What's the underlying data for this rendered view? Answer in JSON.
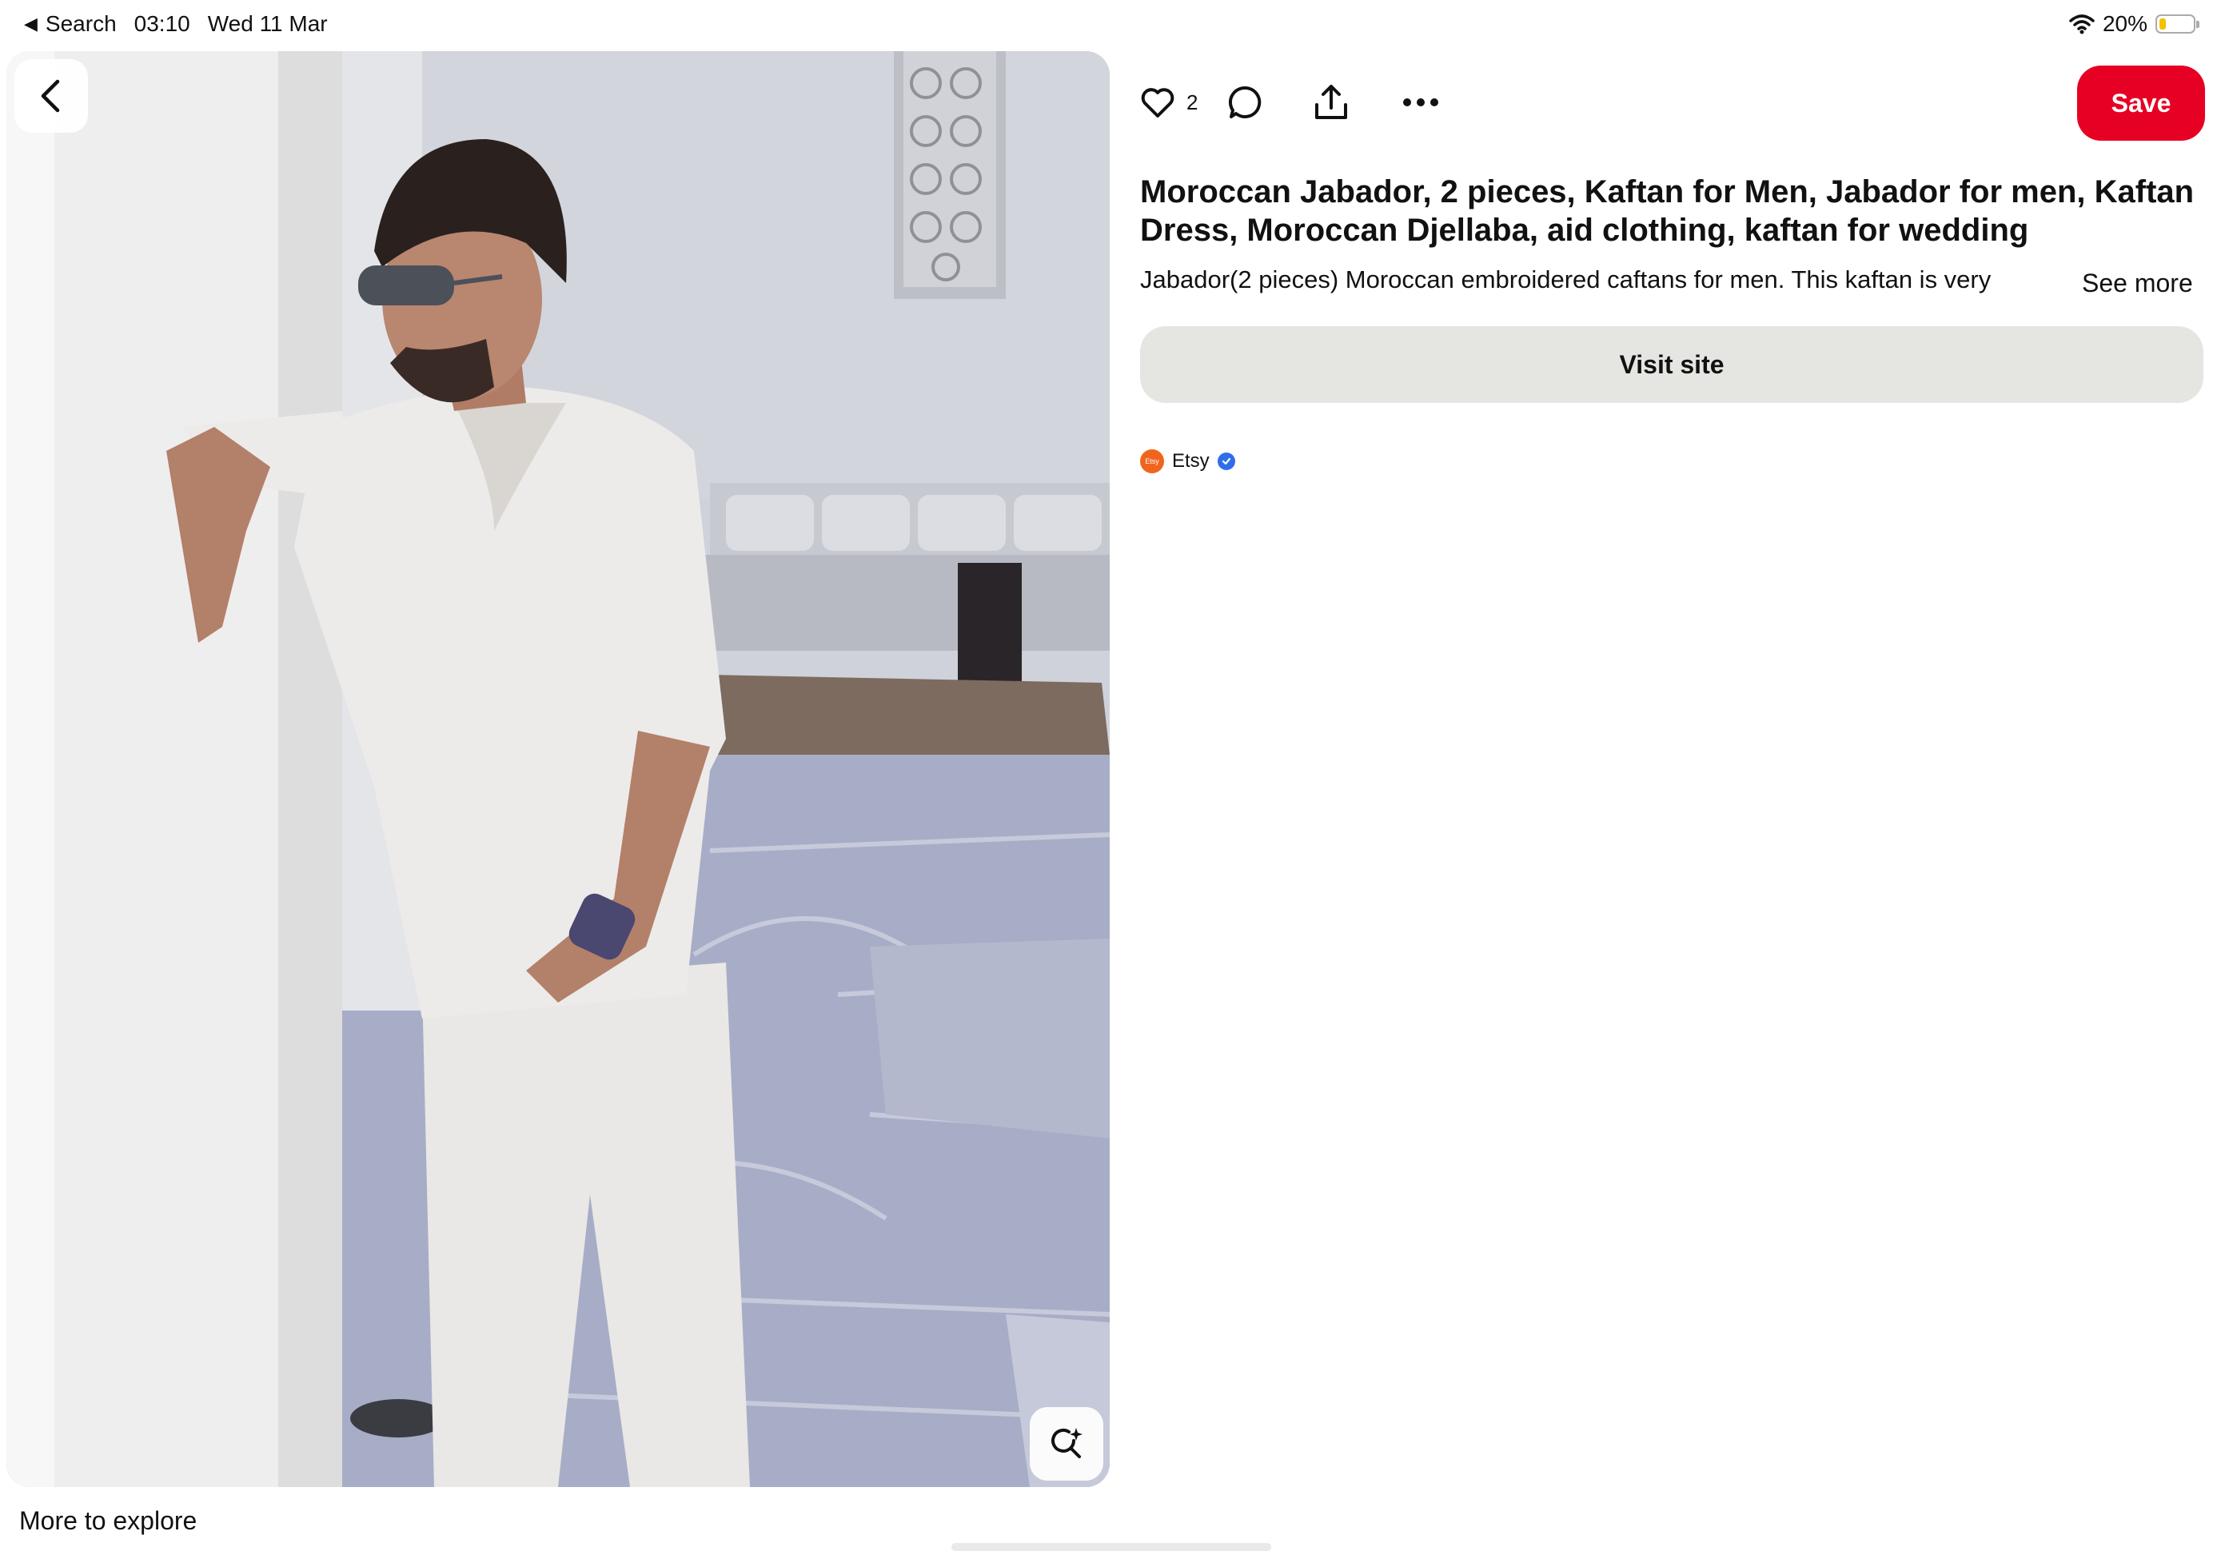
{
  "status_bar": {
    "back_label": "Search",
    "time": "03:10",
    "date": "Wed 11 Mar",
    "battery_percent": "20%",
    "battery_level": 0.2
  },
  "pin": {
    "like_count": "2",
    "save_label": "Save",
    "title": "Moroccan Jabador, 2 pieces, Kaftan for Men, Jabador for men, Kaftan Dress, Moroccan Djellaba, aid clothing, kaftan for wedding",
    "description": "Jabador(2 pieces) Moroccan embroidered caftans for men. This kaftan is very",
    "see_more_label": "See more",
    "visit_label": "Visit site",
    "source_name": "Etsy",
    "source_logo_text": "Etsy"
  },
  "footer": {
    "more_to_explore": "More to explore"
  },
  "icons": {
    "back": "chevron-left-icon",
    "like": "heart-icon",
    "comment": "comment-bubble-icon",
    "share": "share-icon",
    "more": "ellipsis-icon",
    "visual_search": "visual-search-icon",
    "verified": "verified-check-icon"
  },
  "colors": {
    "save_button": "#e60023",
    "visit_button": "#e5e6e1",
    "etsy_brand": "#f1641e",
    "verified_badge": "#2f6ee8"
  }
}
